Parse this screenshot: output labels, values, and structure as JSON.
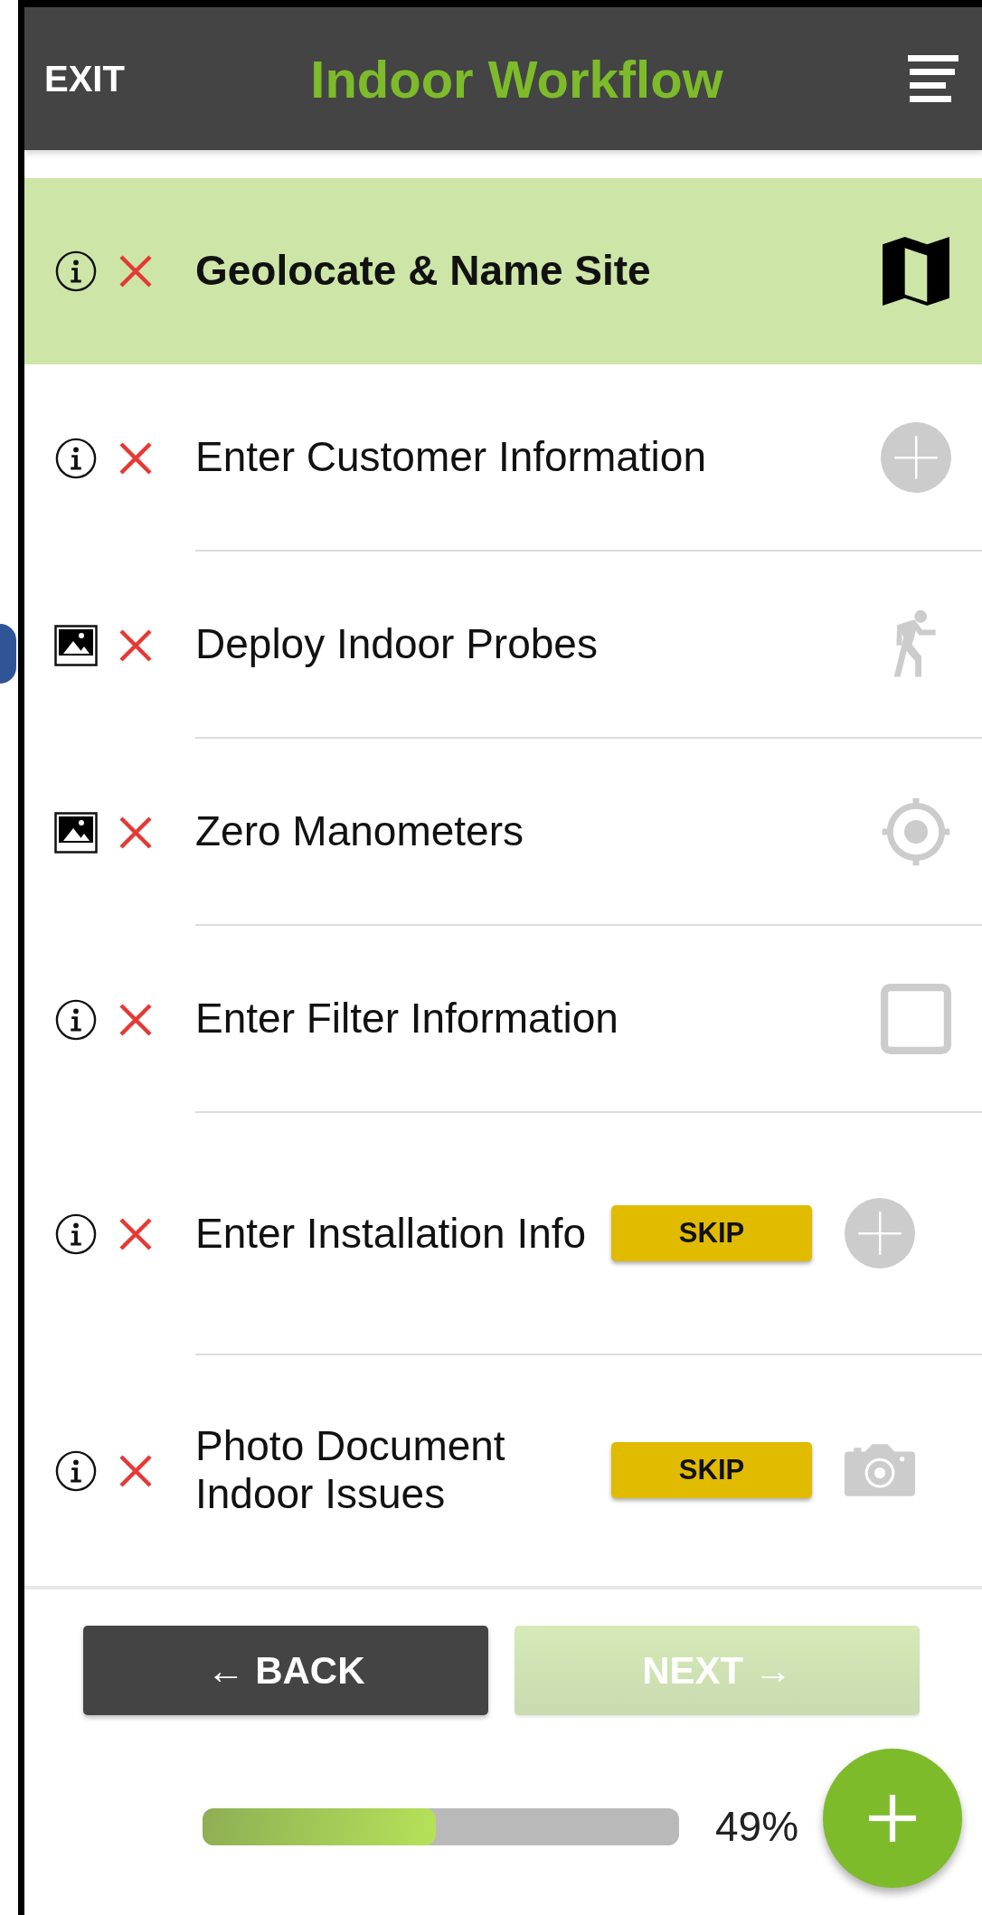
{
  "header": {
    "exit": "EXIT",
    "title": "Indoor Workflow"
  },
  "steps": [
    {
      "label": "Geolocate & Name Site",
      "selected": true
    },
    {
      "label": "Enter Customer Information",
      "selected": false
    },
    {
      "label": "Deploy Indoor Probes",
      "selected": false
    },
    {
      "label": "Zero Manometers",
      "selected": false
    },
    {
      "label": "Enter Filter Information",
      "selected": false
    },
    {
      "label": "Enter Installation Info",
      "selected": false,
      "skip": "SKIP"
    },
    {
      "label": "Photo Document Indoor Issues",
      "selected": false,
      "skip": "SKIP"
    }
  ],
  "back": {
    "label": "← BACK",
    "disabled": false
  },
  "next": {
    "label": "NEXT →",
    "disabled": true
  },
  "progress": {
    "level": 0.49,
    "reading": "49%"
  }
}
